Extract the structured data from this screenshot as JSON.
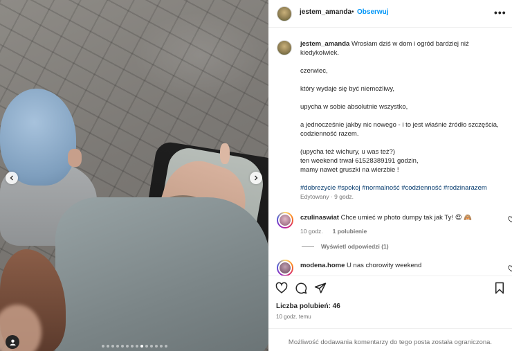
{
  "post": {
    "username": "jestem_amanda",
    "separator": "•",
    "follow_label": "Obserwuj",
    "more_label": "•••"
  },
  "caption": {
    "username": "jestem_amanda",
    "lines": [
      "Wrosłam dziś w dom i ogród bardziej niż kiedykolwiek.",
      "czerwiec,",
      "który wydaje się być niemożliwy,",
      "upycha w sobie absolutnie wszystko,",
      "a jednocześnie jakby nic nowego - i to jest właśnie źródło szczęścia, codzienność razem.",
      "(upycha też wichury, u was też?)",
      "ten weekend trwał 61528389191 godzin,",
      "mamy nawet gruszki na wierzbie !"
    ],
    "hashtags": "#dobrezycie #spokoj #normalność #codzienność #rodzinarazem",
    "edited": "Edytowany · 9 godz."
  },
  "comments": [
    {
      "username": "czulinaswiat",
      "text": "Chce umieć w photo dumpy tak jak Ty! 😍 🙈",
      "time": "10 godz.",
      "likes": "1 polubienie"
    },
    {
      "username": "modena.home",
      "text": "U nas chorowity weekend"
    }
  ],
  "replies_label": "Wyświetl odpowiedzi (1)",
  "likes_label": "Liczba polubień: 46",
  "timestamp": "10 godz. temu",
  "restricted_notice": "Możliwość dodawania komentarzy do tego posta została ograniczona.",
  "carousel": {
    "total": 14,
    "current": 9
  },
  "icons": {
    "prev": "chevron-left-icon",
    "next": "chevron-right-icon",
    "tag": "user-tag-icon",
    "like": "heart-icon",
    "comment": "comment-icon",
    "share": "share-icon",
    "save": "bookmark-icon"
  },
  "colors": {
    "follow": "#0095f6",
    "hashtag": "#00376b",
    "muted": "#737373"
  }
}
